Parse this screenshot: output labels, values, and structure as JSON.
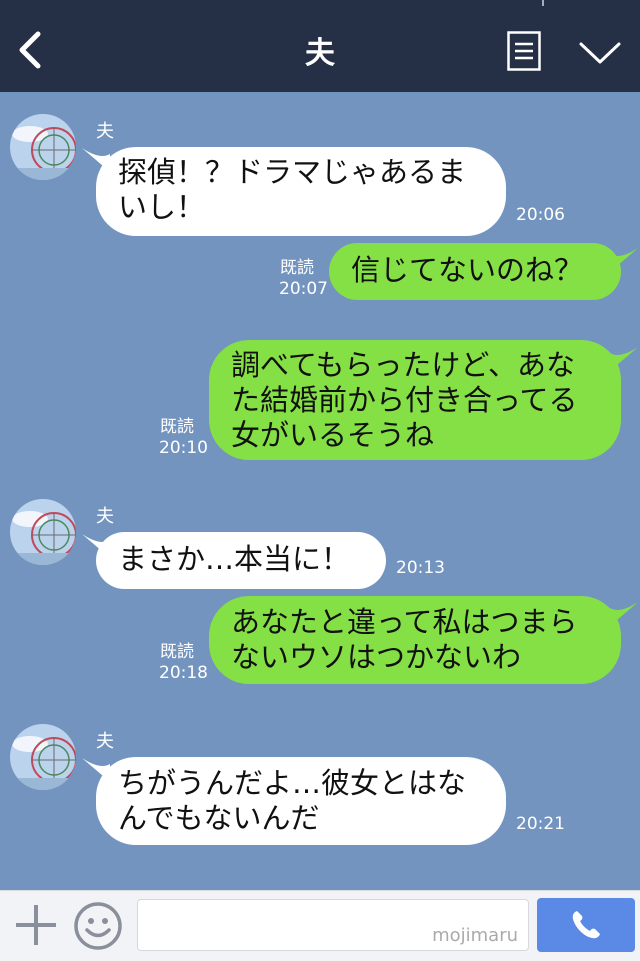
{
  "header": {
    "title": "夫"
  },
  "messages": [
    {
      "sender": "夫",
      "lines": [
        "探偵！？ドラマじゃあるま",
        "いし！"
      ],
      "time": "20:06"
    },
    {
      "lines": [
        "信じてないのね？"
      ],
      "read": "既読",
      "time": "20:07"
    },
    {
      "lines": [
        "調べてもらったけど、あな",
        "た結婚前から付き合ってる",
        "女がいるそうね"
      ],
      "read": "既読",
      "time": "20:10"
    },
    {
      "sender": "夫",
      "lines": [
        "まさか…本当に！"
      ],
      "time": "20:13"
    },
    {
      "lines": [
        "あなたと違って私はつまら",
        "ないウソはつかないわ"
      ],
      "read": "既読",
      "time": "20:18"
    },
    {
      "sender": "夫",
      "lines": [
        "ちがうんだよ…彼女とはな",
        "んでもないんだ"
      ],
      "time": "20:21"
    }
  ],
  "input": {
    "watermark": "mojimaru"
  },
  "colors": {
    "header": "#252f45",
    "background": "#7494c0",
    "outgoing": "#84e045",
    "incoming": "#ffffff",
    "call": "#5b8ae6"
  },
  "icons": [
    "back-icon",
    "menu-icon",
    "chevron-down-icon",
    "avatar",
    "plus-icon",
    "smile-icon",
    "phone-icon"
  ]
}
